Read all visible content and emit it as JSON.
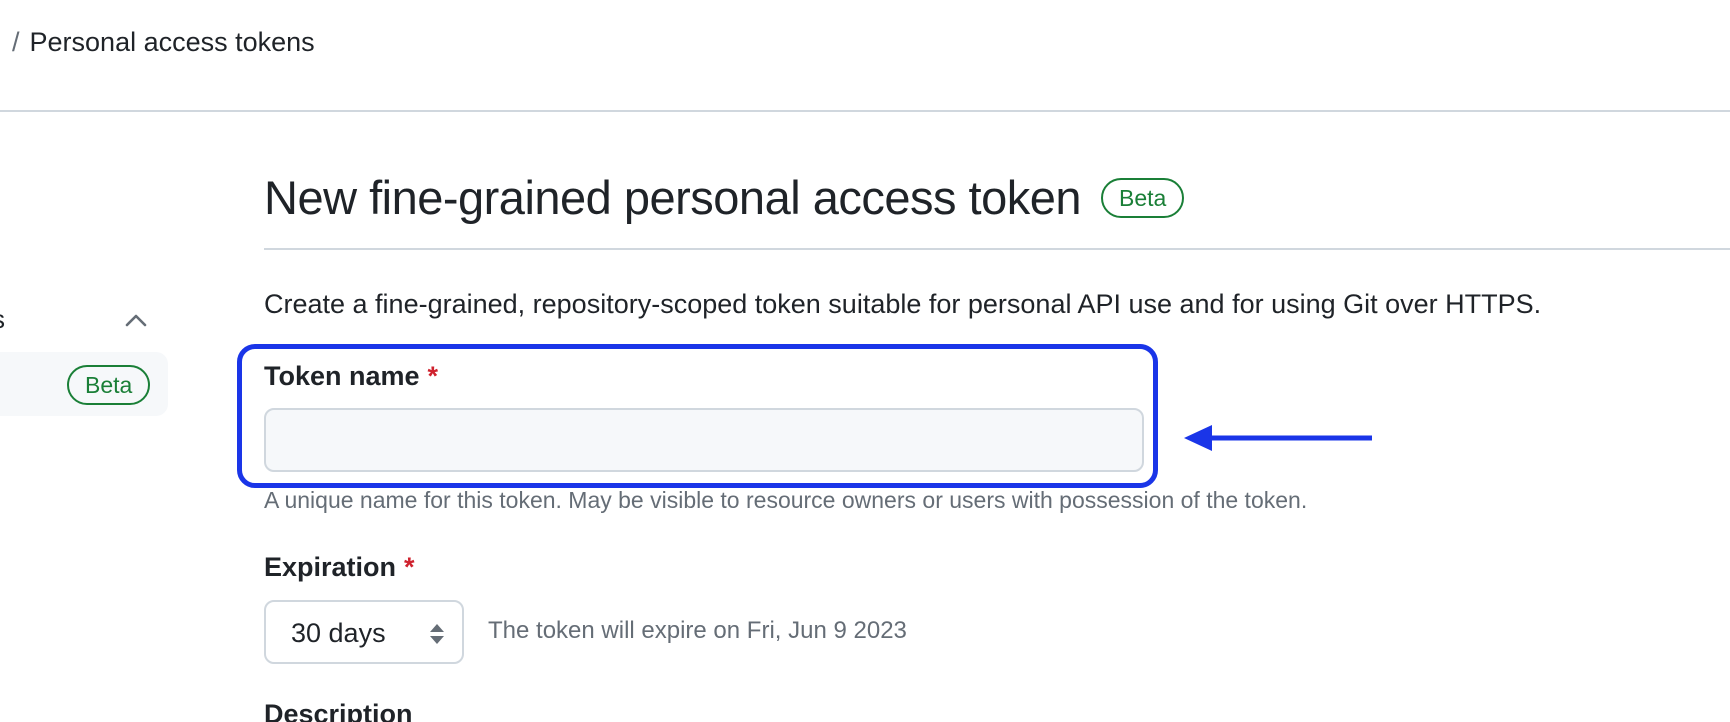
{
  "breadcrumb": {
    "separator": "/",
    "current": "Personal access tokens"
  },
  "sidebar": {
    "partial_section_label": "s",
    "collapse_icon": "chevron-up-icon",
    "active_item_badge": "Beta"
  },
  "main": {
    "title": "New fine-grained personal access token",
    "title_badge": "Beta",
    "intro": "Create a fine-grained, repository-scoped token suitable for personal API use and for using Git over HTTPS."
  },
  "form": {
    "required_marker": "*",
    "token_name": {
      "label": "Token name",
      "value": "",
      "hint": "A unique name for this token. May be visible to resource owners or users with possession of the token."
    },
    "expiration": {
      "label": "Expiration",
      "selected": "30 days",
      "note": "The token will expire on Fri, Jun 9 2023"
    },
    "description": {
      "label": "Description"
    }
  },
  "annotation": {
    "color": "#1a35e8",
    "arrow_icon": "left-arrow-icon"
  },
  "colors": {
    "beta_green": "#1a7f37",
    "required_red": "#cf222e",
    "muted_text": "#656d76",
    "border": "#d0d7de"
  }
}
